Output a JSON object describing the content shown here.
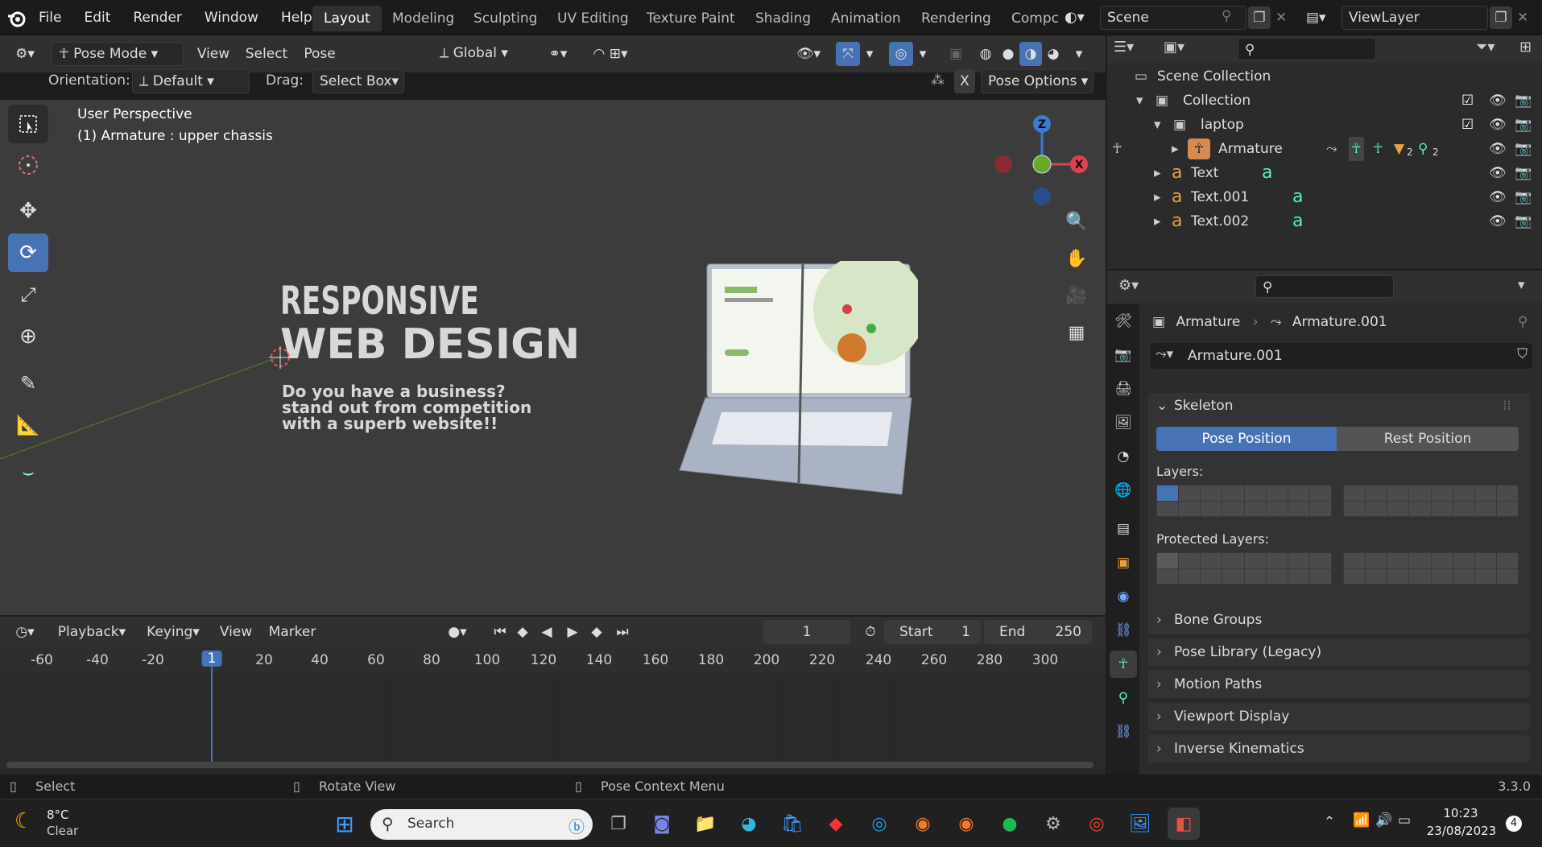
{
  "app": {
    "name": "Blender",
    "version": "3.3.0"
  },
  "menu": [
    "File",
    "Edit",
    "Render",
    "Window",
    "Help"
  ],
  "workspaces": [
    "Layout",
    "Modeling",
    "Sculpting",
    "UV Editing",
    "Texture Paint",
    "Shading",
    "Animation",
    "Rendering",
    "Compc"
  ],
  "active_workspace": "Layout",
  "scene": {
    "label": "Scene",
    "viewlayer": "ViewLayer"
  },
  "viewport_header": {
    "mode": "Pose Mode",
    "menus": [
      "View",
      "Select",
      "Pose"
    ],
    "transform": "Global"
  },
  "tool_settings": {
    "orientation_label": "Orientation:",
    "orientation_value": "Default",
    "drag_label": "Drag:",
    "drag_value": "Select Box",
    "x_label": "X",
    "pose_options": "Pose Options"
  },
  "viewport": {
    "perspective": "User Perspective",
    "active_object": "(1) Armature : upper chassis",
    "scene_text": {
      "line1": "RESPONSIVE",
      "line2": "WEB DESIGN",
      "line3": "Do you have a business?",
      "line4": "stand out from competition",
      "line5": "with a superb website!!"
    },
    "gizmo": {
      "z": "Z",
      "x": "X"
    }
  },
  "outliner": {
    "scene_collection": "Scene Collection",
    "items": [
      {
        "name": "Collection"
      },
      {
        "name": "laptop"
      },
      {
        "name": "Armature",
        "badge1": "2",
        "badge2": "2"
      },
      {
        "name": "Text"
      },
      {
        "name": "Text.001"
      },
      {
        "name": "Text.002"
      }
    ]
  },
  "properties": {
    "breadcrumb_obj": "Armature",
    "breadcrumb_data": "Armature.001",
    "datablock": "Armature.001",
    "skeleton": {
      "title": "Skeleton",
      "pose_position": "Pose Position",
      "rest_position": "Rest Position",
      "layers_label": "Layers:",
      "protected_label": "Protected Layers:"
    },
    "panels": [
      "Bone Groups",
      "Pose Library (Legacy)",
      "Motion Paths",
      "Viewport Display",
      "Inverse Kinematics"
    ]
  },
  "timeline": {
    "menus": [
      "Playback",
      "Keying",
      "View",
      "Marker"
    ],
    "current_frame": "1",
    "start_label": "Start",
    "start": "1",
    "end_label": "End",
    "end": "250",
    "ruler": [
      "-60",
      "-40",
      "-20",
      "1",
      "20",
      "40",
      "60",
      "80",
      "100",
      "120",
      "140",
      "160",
      "180",
      "200",
      "220",
      "240",
      "260",
      "280",
      "300"
    ]
  },
  "statusbar": {
    "select": "Select",
    "rotate": "Rotate View",
    "context": "Pose Context Menu",
    "version": "3.3.0"
  },
  "taskbar": {
    "weather_temp": "8°C",
    "weather_desc": "Clear",
    "search_placeholder": "Search",
    "time": "10:23",
    "date": "23/08/2023",
    "notif": "4"
  }
}
